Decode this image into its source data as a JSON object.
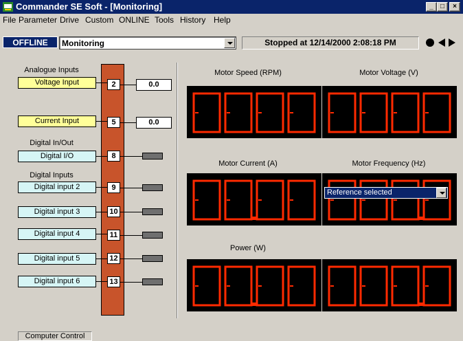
{
  "window": {
    "title": "Commander SE Soft - [Monitoring]",
    "icon": "app-icon",
    "buttons": {
      "minimize": "_",
      "maximize": "□",
      "close": "×"
    }
  },
  "menu": [
    "File",
    "Parameter",
    "Drive",
    "Custom",
    "ONLINE",
    "Tools",
    "History",
    "Help"
  ],
  "toolbar": {
    "mode_badge": "OFFLINE",
    "page_select": "Monitoring",
    "status": "Stopped at 12/14/2000 2:08:18 PM",
    "icons": [
      "record-icon",
      "nav-left-icon",
      "nav-right-icon"
    ]
  },
  "io": {
    "analogue_heading": "Analogue Inputs",
    "analog": [
      {
        "label": "Voltage Input",
        "terminal": "2",
        "value": "0.0"
      },
      {
        "label": "Current Input",
        "terminal": "5",
        "value": "0.0"
      }
    ],
    "digital_io_heading": "Digital In/Out",
    "digital_io": [
      {
        "label": "Digital I/O",
        "terminal": "8",
        "state": "off"
      }
    ],
    "digital_inputs_heading": "Digital Inputs",
    "digital_inputs": [
      {
        "label": "Digital input 2",
        "terminal": "9",
        "state": "off"
      },
      {
        "label": "Digital input 3",
        "terminal": "10",
        "state": "off"
      },
      {
        "label": "Digital input 4",
        "terminal": "11",
        "state": "off"
      },
      {
        "label": "Digital input 5",
        "terminal": "12",
        "state": "off"
      },
      {
        "label": "Digital input 6",
        "terminal": "13",
        "state": "off"
      }
    ]
  },
  "displays": [
    {
      "title": "Motor Speed (RPM)",
      "value": "0000"
    },
    {
      "title": "Motor Voltage (V)",
      "value": "0000"
    },
    {
      "title": "Motor Current (A)",
      "value": "00.00"
    },
    {
      "title": "Motor Frequency (Hz)",
      "value": "000.0"
    },
    {
      "title": "Power (W)",
      "value": "00.00"
    },
    {
      "title": "",
      "value": "000.0"
    }
  ],
  "reference_select": "Reference selected",
  "statusbar": {
    "tab": "Computer Control"
  },
  "colors": {
    "segment": "#ff2a00",
    "display_bg": "#000000",
    "terminal_strip": "#c8542b",
    "analog_box": "#ffff99",
    "digital_box": "#d6f5f5",
    "title_bar": "#0a246a"
  }
}
